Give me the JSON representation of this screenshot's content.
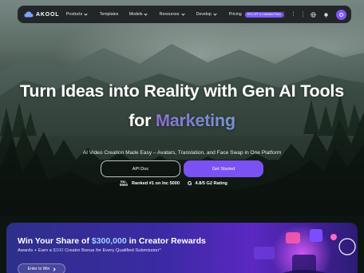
{
  "brand": {
    "name": "AKOOL"
  },
  "nav": {
    "items": [
      {
        "label": "Products",
        "dropdown": true
      },
      {
        "label": "Templates",
        "dropdown": false
      },
      {
        "label": "Models",
        "dropdown": true
      },
      {
        "label": "Resources",
        "dropdown": true
      },
      {
        "label": "Develop",
        "dropdown": true
      },
      {
        "label": "Pricing",
        "dropdown": false
      }
    ],
    "pricing_badge": "50% OFF & Unlimited Plans",
    "icons": [
      "more-vertical-icon",
      "globe-icon",
      "bell-icon",
      "user-avatar-icon"
    ]
  },
  "hero": {
    "headline_line1": "Turn Ideas into Reality with Gen AI Tools",
    "headline_for": "for",
    "headline_highlight": "Marketing",
    "subtitle": "AI Video Creation Made Easy – Avatars, Translation, and Face Swap in One Platform",
    "cta_secondary": "API Doc",
    "cta_primary": "Get Started",
    "rating_inc_logo_top": "Inc.",
    "rating_inc_logo_bottom": "5000",
    "rating_inc_text": "Ranked #1 on Inc 5000",
    "rating_g2_logo": "G",
    "rating_g2_text": "4.8/5 G2 Rating"
  },
  "banner": {
    "title_prefix": "Win Your Share of",
    "title_amount": "$300,000",
    "title_suffix": "in Creator Rewards",
    "sub_prefix": "Awards + Earn a",
    "sub_amount": "$100",
    "sub_suffix": "Creator Bonus for Every Qualified Submission*",
    "button": "Enter to Win"
  },
  "colors": {
    "accent": "#7a52f4",
    "headline_gradient_start": "#a98bff",
    "headline_gradient_end": "#8fb6ff",
    "banner_bg": "#3b2aa4",
    "nav_bg": "#1c1e22"
  }
}
